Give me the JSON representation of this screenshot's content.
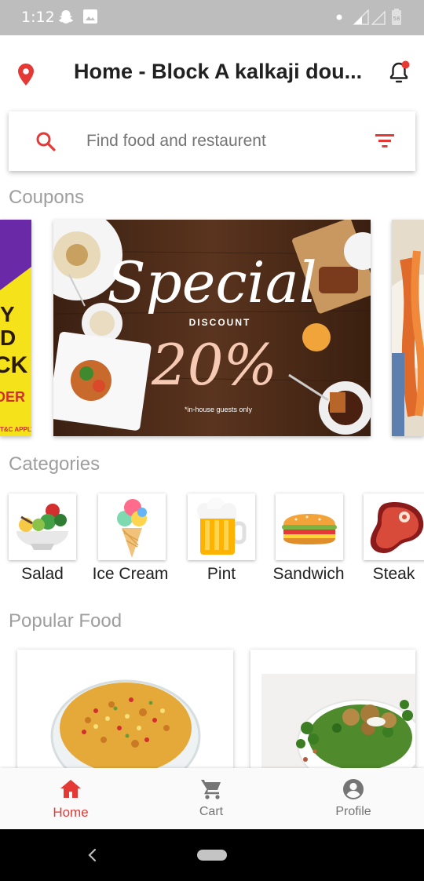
{
  "status_bar": {
    "time": "1:12"
  },
  "header": {
    "address": "Home - Block A kalkaji dou..."
  },
  "search": {
    "placeholder": "Find food and restaurent"
  },
  "sections": {
    "coupons": "Coupons",
    "categories": "Categories",
    "popular": "Popular Food"
  },
  "coupon": {
    "script_text": "Special",
    "discount_label": "DISCOUNT",
    "percent": "20%",
    "fine_print": "*in-house guests only"
  },
  "coupon_left": {
    "text": [
      "Y",
      "D",
      "CK",
      "DER",
      "T&C APPLY"
    ]
  },
  "categories": [
    {
      "label": "Salad"
    },
    {
      "label": "Ice Cream"
    },
    {
      "label": "Pint"
    },
    {
      "label": "Sandwich"
    },
    {
      "label": "Steak"
    }
  ],
  "bottom_nav": [
    {
      "label": "Home",
      "active": true
    },
    {
      "label": "Cart",
      "active": false
    },
    {
      "label": "Profile",
      "active": false
    }
  ],
  "colors": {
    "accent": "#e53935",
    "muted": "#757575",
    "header_text": "#212121"
  }
}
